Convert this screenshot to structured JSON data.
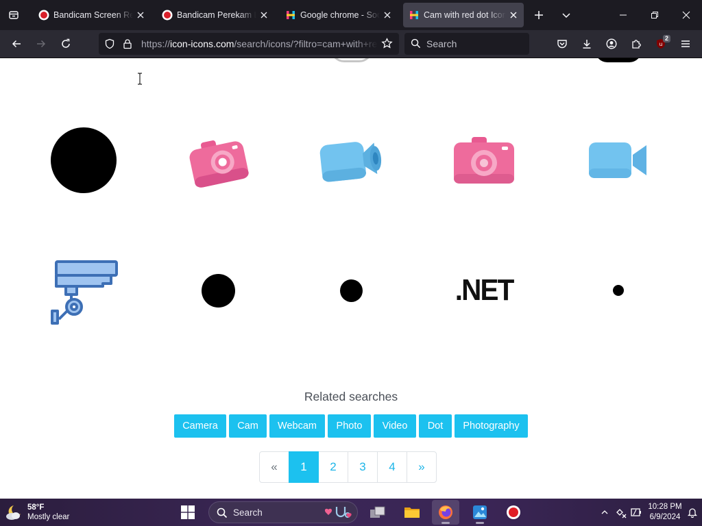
{
  "browser": {
    "tabs": [
      {
        "title": "Bandicam Screen Reco",
        "favicon": "bandicam-icon",
        "active": false
      },
      {
        "title": "Bandicam Perekam Lay",
        "favicon": "bandicam-icon",
        "active": false
      },
      {
        "title": "Google chrome - Social",
        "favicon": "icon-icons-favicon",
        "active": false
      },
      {
        "title": "Cam with red dot Icons",
        "favicon": "icon-icons-favicon",
        "active": true
      }
    ],
    "url_prefix": "https://",
    "url_host": "icon-icons.com",
    "url_path": "/search/icons/?filtro=cam+with+red+dot",
    "search_placeholder": "Search",
    "extension_badge": "2"
  },
  "results": {
    "row1": [
      {
        "name": "black-circle"
      },
      {
        "name": "pink-camera-3d"
      },
      {
        "name": "blue-video-camera-3d"
      },
      {
        "name": "pink-camera-3d"
      },
      {
        "name": "blue-video-camera-3d"
      }
    ],
    "row2": [
      {
        "name": "security-camera"
      },
      {
        "name": "black-dot-medium"
      },
      {
        "name": "black-dot-small"
      },
      {
        "name": "dotnet-logo",
        "text": ".NET"
      },
      {
        "name": "black-dot-tiny"
      }
    ]
  },
  "related": {
    "title": "Related searches",
    "tags": [
      "Camera",
      "Cam",
      "Webcam",
      "Photo",
      "Video",
      "Dot",
      "Photography"
    ]
  },
  "pagination": {
    "prev": "«",
    "pages": [
      "1",
      "2",
      "3",
      "4"
    ],
    "current": "1",
    "next": "»"
  },
  "taskbar": {
    "weather_temp": "58°F",
    "weather_desc": "Mostly clear",
    "search_label": "Search",
    "time": "10:28 PM",
    "date": "6/9/2024"
  },
  "colors": {
    "accent": "#1cc1ef",
    "tab_bar": "#1c1b22",
    "nav_bar": "#2b2a33",
    "pink_camera": "#ee6b9c",
    "blue_camera": "#72c3ef"
  }
}
